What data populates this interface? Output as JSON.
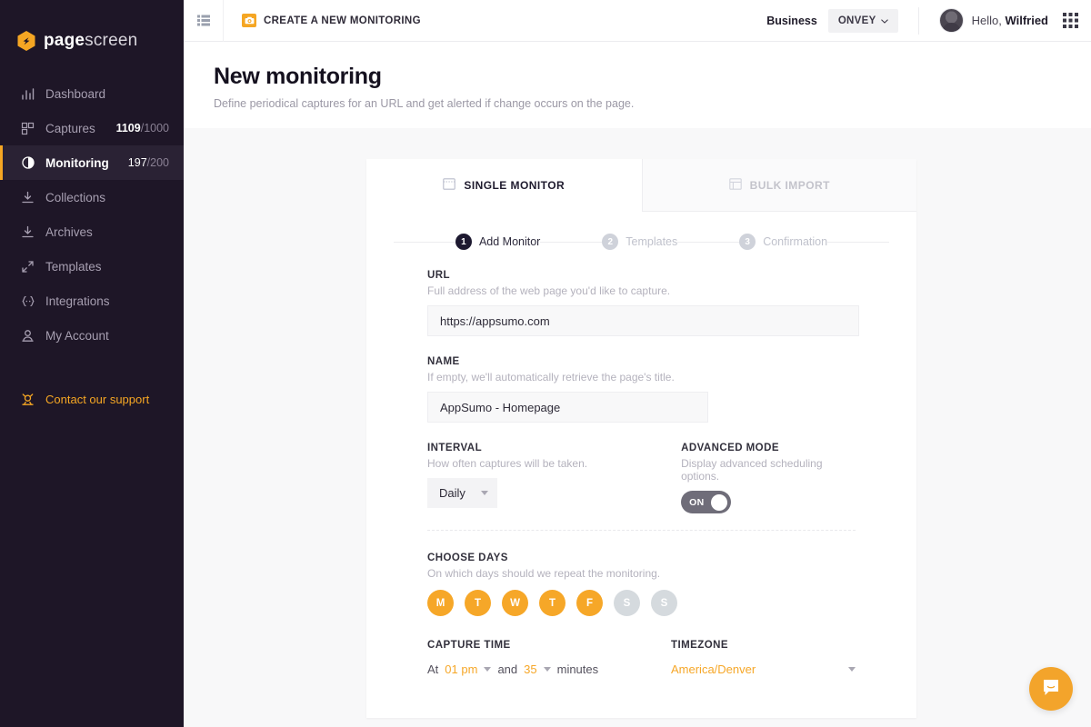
{
  "sidebar": {
    "logo": {
      "primary": "page",
      "secondary": "screen",
      "icon": "hexagon-logo-icon"
    },
    "items": [
      {
        "label": "Dashboard",
        "icon": "bar-chart-icon",
        "count": null,
        "active": false
      },
      {
        "label": "Captures",
        "icon": "grid-copy-icon",
        "count": {
          "used": "1109",
          "total": "/1000"
        },
        "active": false
      },
      {
        "label": "Monitoring",
        "icon": "half-circle-icon",
        "count": {
          "used": "197",
          "total": "/200"
        },
        "active": true
      },
      {
        "label": "Collections",
        "icon": "download-icon",
        "count": null,
        "active": false
      },
      {
        "label": "Archives",
        "icon": "download-icon",
        "count": null,
        "active": false
      },
      {
        "label": "Templates",
        "icon": "expand-icon",
        "count": null,
        "active": false
      },
      {
        "label": "Integrations",
        "icon": "braces-icon",
        "count": null,
        "active": false
      },
      {
        "label": "My Account",
        "icon": "user-icon",
        "count": null,
        "active": false
      }
    ],
    "support": {
      "label": "Contact our support",
      "icon": "lifebuoy-icon"
    }
  },
  "topbar": {
    "list_toggle_icon": "list-icon",
    "breadcrumb": "CREATE A NEW MONITORING",
    "breadcrumb_icon": "camera-icon",
    "plan": "Business",
    "org": "ONVEY",
    "greeting_prefix": "Hello, ",
    "user_name": "Wilfried",
    "app_grid_icon": "app-grid-icon"
  },
  "page": {
    "title": "New monitoring",
    "subtitle": "Define periodical captures for an URL and get alerted if change occurs on the page."
  },
  "tabs": [
    {
      "label": "SINGLE MONITOR",
      "icon": "single-window-icon",
      "active": true
    },
    {
      "label": "BULK IMPORT",
      "icon": "bulk-window-icon",
      "active": false
    }
  ],
  "steps": [
    {
      "num": "1",
      "label": "Add Monitor",
      "state": "done"
    },
    {
      "num": "2",
      "label": "Templates",
      "state": "todo"
    },
    {
      "num": "3",
      "label": "Confirmation",
      "state": "todo"
    }
  ],
  "form": {
    "url": {
      "label": "URL",
      "help": "Full address of the web page you'd like to capture.",
      "value": "https://appsumo.com",
      "placeholder": "https://"
    },
    "name": {
      "label": "NAME",
      "help": "If empty, we'll automatically retrieve the page's title.",
      "value": "AppSumo - Homepage",
      "placeholder": "Name"
    },
    "interval": {
      "label": "INTERVAL",
      "help": "How often captures will be taken.",
      "value": "Daily"
    },
    "advanced_mode": {
      "label": "ADVANCED MODE",
      "help": "Display advanced scheduling options.",
      "state": "ON"
    },
    "choose_days": {
      "label": "CHOOSE DAYS",
      "help": "On which days should we repeat the monitoring.",
      "days": [
        {
          "letter": "M",
          "selected": true
        },
        {
          "letter": "T",
          "selected": true
        },
        {
          "letter": "W",
          "selected": true
        },
        {
          "letter": "T",
          "selected": true
        },
        {
          "letter": "F",
          "selected": true
        },
        {
          "letter": "S",
          "selected": false
        },
        {
          "letter": "S",
          "selected": false
        }
      ]
    },
    "capture_time": {
      "label": "CAPTURE TIME",
      "prefix": "At",
      "hour": "01 pm",
      "conjunction": "and",
      "minutes": "35",
      "suffix": "minutes"
    },
    "timezone": {
      "label": "TIMEZONE",
      "value": "America/Denver"
    }
  },
  "widgets": {
    "intercom_icon": "chat-bubble-icon"
  },
  "colors": {
    "accent": "#f5a623",
    "sidebar_bg": "#1e1627",
    "sidebar_active_bg": "#2a2234",
    "canvas_bg": "#f8f8f9",
    "day_off": "#d5dade",
    "toggle_on_track": "#6f6d79",
    "step_done": "#1d1930",
    "step_todo": "#cfd2da"
  }
}
